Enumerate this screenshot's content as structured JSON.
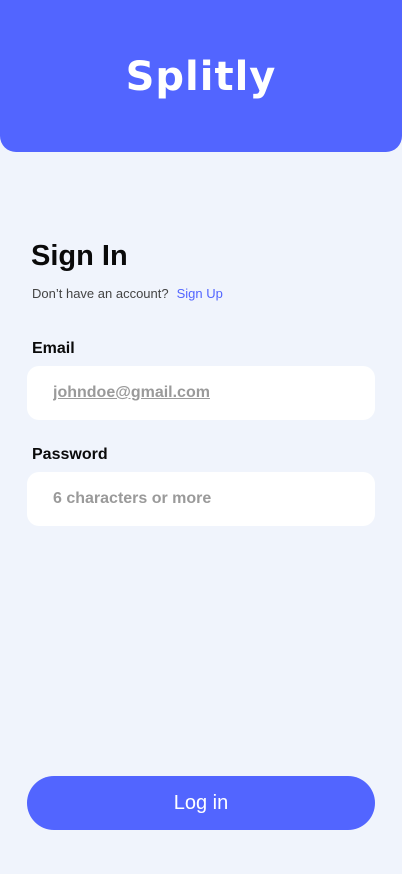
{
  "header": {
    "brand": "Splitly"
  },
  "signin": {
    "title": "Sign In",
    "signup_prompt": "Don’t have an account?",
    "signup_link": "Sign Up"
  },
  "fields": {
    "email": {
      "label": "Email",
      "placeholder": "johndoe@gmail.com",
      "value": ""
    },
    "password": {
      "label": "Password",
      "placeholder": "6 characters or more",
      "value": ""
    }
  },
  "actions": {
    "login_label": "Log in"
  },
  "colors": {
    "primary": "#5265FF",
    "background": "#F0F4FC",
    "input_background": "#FFFFFF",
    "placeholder": "#9A9A9A",
    "text": "#0A0A0A"
  }
}
